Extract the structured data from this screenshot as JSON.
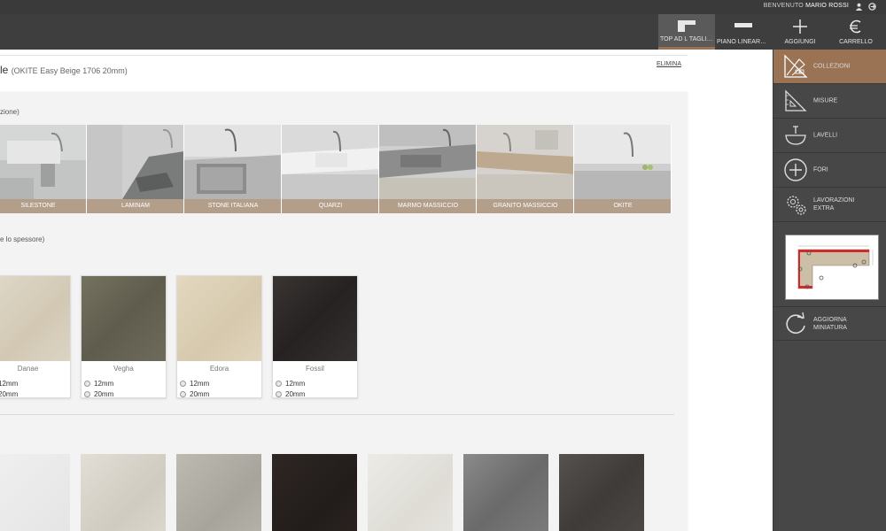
{
  "topbar": {
    "welcome_prefix": "BENVENUTO",
    "user_name": "MARIO ROSSI",
    "icons": [
      "user-icon",
      "logout-icon"
    ]
  },
  "header": {
    "buttons": [
      {
        "label": "TOP AD L TAGLIO ...",
        "icon": "top-l-icon",
        "active": true
      },
      {
        "label": "PIANO LINEARE / ...",
        "icon": "piano-lineare-icon",
        "active": false
      },
      {
        "label": "AGGIUNGI",
        "icon": "plus-icon",
        "active": false
      },
      {
        "label": "CARRELLO",
        "icon": "euro-icon",
        "active": false
      }
    ]
  },
  "main": {
    "title": "le",
    "title_sub": "(OKITE Easy Beige 1706 20mm)",
    "elimina": "ELIMINA",
    "collection_label": "zione)",
    "thickness_label": "e lo spessore)",
    "collections": [
      "SILESTONE",
      "LAMINAM",
      "STONE ITALIANA",
      "QUARZI",
      "MARMO MASSICCIO",
      "GRANITO MASSICCIO",
      "OKITE"
    ],
    "materials": [
      {
        "name": "Danae",
        "opt1": "12mm",
        "opt2": "20mm",
        "color": "#d9d0bf"
      },
      {
        "name": "Vegha",
        "opt1": "12mm",
        "opt2": "20mm",
        "color": "#6b685a"
      },
      {
        "name": "Edora",
        "opt1": "12mm",
        "opt2": "20mm",
        "color": "#dcd0b8"
      },
      {
        "name": "Fossil",
        "opt1": "12mm",
        "opt2": "20mm",
        "color": "#2f2b2a"
      }
    ],
    "swatches_row2": [
      "#ededed",
      "#dcd8cf",
      "#b3b0a8",
      "#2b2422",
      "#e7e5df",
      "#7a7a7a",
      "#4a4744"
    ]
  },
  "sidebar": {
    "items": [
      {
        "label": "COLLEZIONI",
        "icon": "collections-icon",
        "active": true
      },
      {
        "label": "MISURE",
        "icon": "ruler-triangle-icon",
        "active": false
      },
      {
        "label": "LAVELLI",
        "icon": "sink-icon",
        "active": false
      },
      {
        "label": "FORI",
        "icon": "add-hole-icon",
        "active": false
      },
      {
        "label": "LAVORAZIONI EXTRA",
        "icon": "gears-icon",
        "active": false
      },
      {
        "label": "AGGIORNA MINIATURA",
        "icon": "refresh-icon",
        "active": false
      }
    ]
  }
}
